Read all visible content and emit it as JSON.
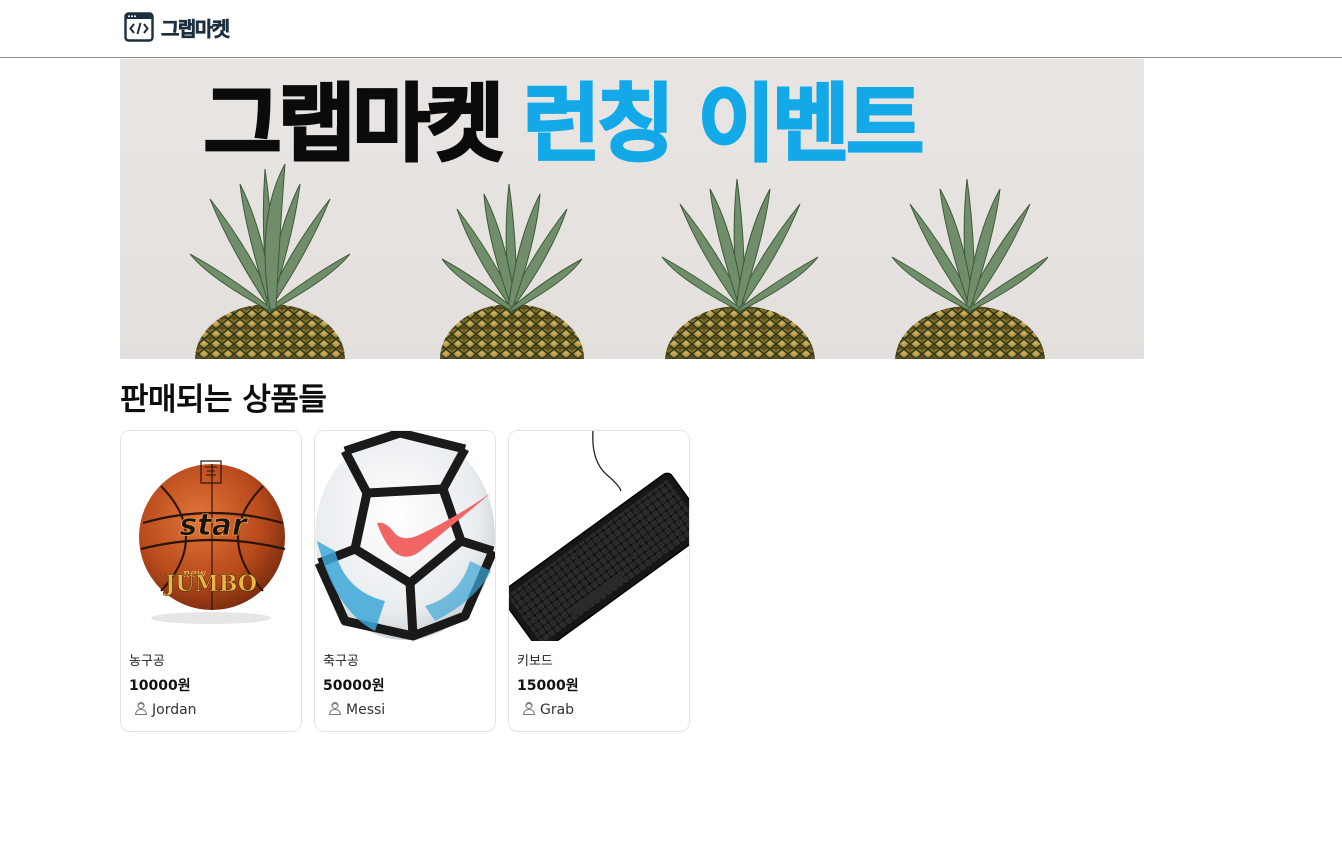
{
  "header": {
    "logo_text": "그랩마켓",
    "logo_icon": "code-window-icon"
  },
  "banner": {
    "title_dark": "그랩마켓",
    "title_accent": "런칭 이벤트",
    "accent_color": "#13a9e9",
    "image": "pineapples-banner"
  },
  "main": {
    "section_title": "판매되는 상품들",
    "products": [
      {
        "name": "농구공",
        "price": "10000원",
        "seller": "Jordan",
        "image": "basketball"
      },
      {
        "name": "축구공",
        "price": "50000원",
        "seller": "Messi",
        "image": "soccer-ball"
      },
      {
        "name": "키보드",
        "price": "15000원",
        "seller": "Grab",
        "image": "keyboard"
      }
    ],
    "seller_icon": "avatar-icon"
  }
}
